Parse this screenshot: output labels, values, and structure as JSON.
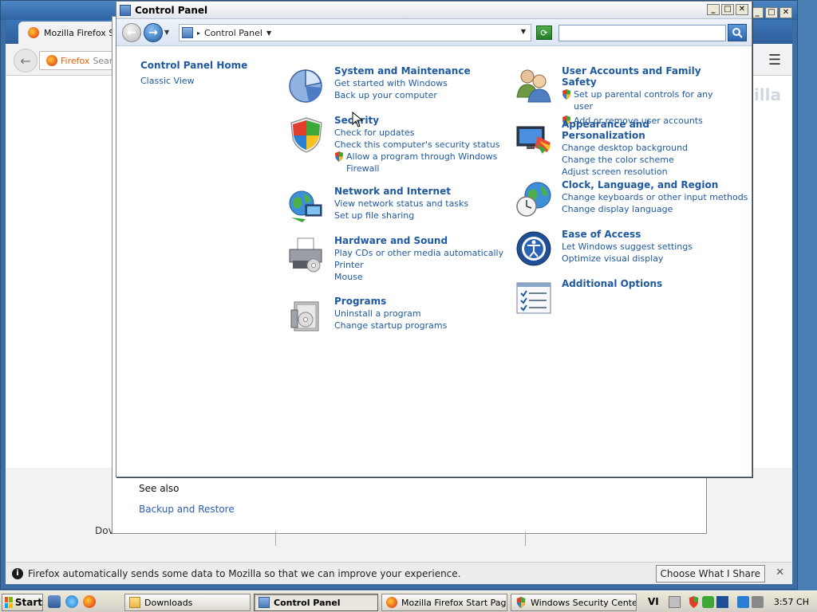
{
  "firefox": {
    "tab_title": "Mozilla Firefox Start",
    "url_badge": "Firefox",
    "url_placeholder": "Search",
    "brand_text": "zilla",
    "partial_text": "Dov",
    "notification": "Firefox automatically sends some data to Mozilla so that we can improve your experience.",
    "share_button": "Choose What I Share"
  },
  "security_window": {
    "see_also": "See also",
    "backup_link": "Backup and Restore"
  },
  "control_panel": {
    "title": "Control Panel",
    "address": "Control Panel",
    "search_placeholder": "",
    "sidebar": {
      "home": "Control Panel Home",
      "classic": "Classic View"
    },
    "categories": [
      {
        "title": "System and Maintenance",
        "icon": "pie-chart-icon",
        "links": [
          {
            "text": "Get started with Windows",
            "shield": false
          },
          {
            "text": "Back up your computer",
            "shield": false
          }
        ]
      },
      {
        "title": "Security",
        "icon": "security-shield-icon",
        "links": [
          {
            "text": "Check for updates",
            "shield": false
          },
          {
            "text": "Check this computer's security status",
            "shield": false
          },
          {
            "text": "Allow a program through Windows Firewall",
            "shield": true
          }
        ]
      },
      {
        "title": "Network and Internet",
        "icon": "globe-network-icon",
        "links": [
          {
            "text": "View network status and tasks",
            "shield": false
          },
          {
            "text": "Set up file sharing",
            "shield": false
          }
        ]
      },
      {
        "title": "Hardware and Sound",
        "icon": "printer-icon",
        "links": [
          {
            "text": "Play CDs or other media automatically",
            "shield": false
          },
          {
            "text": "Printer",
            "shield": false
          },
          {
            "text": "Mouse",
            "shield": false
          }
        ]
      },
      {
        "title": "Programs",
        "icon": "programs-box-icon",
        "links": [
          {
            "text": "Uninstall a program",
            "shield": false
          },
          {
            "text": "Change startup programs",
            "shield": false
          }
        ]
      },
      {
        "title": "User Accounts and Family Safety",
        "icon": "users-icon",
        "links": [
          {
            "text": "Set up parental controls for any user",
            "shield": true
          },
          {
            "text": "Add or remove user accounts",
            "shield": true
          }
        ]
      },
      {
        "title": "Appearance and Personalization",
        "icon": "monitor-paint-icon",
        "links": [
          {
            "text": "Change desktop background",
            "shield": false
          },
          {
            "text": "Change the color scheme",
            "shield": false
          },
          {
            "text": "Adjust screen resolution",
            "shield": false
          }
        ]
      },
      {
        "title": "Clock, Language, and Region",
        "icon": "clock-globe-icon",
        "links": [
          {
            "text": "Change keyboards or other input methods",
            "shield": false
          },
          {
            "text": "Change display language",
            "shield": false
          }
        ]
      },
      {
        "title": "Ease of Access",
        "icon": "ease-of-access-icon",
        "links": [
          {
            "text": "Let Windows suggest settings",
            "shield": false
          },
          {
            "text": "Optimize visual display",
            "shield": false
          }
        ]
      },
      {
        "title": "Additional Options",
        "icon": "checklist-icon",
        "links": []
      }
    ]
  },
  "taskbar": {
    "start": "Start",
    "buttons": [
      {
        "label": "Downloads",
        "active": false
      },
      {
        "label": "Control Panel",
        "active": true
      },
      {
        "label": "Mozilla Firefox Start Pag...",
        "active": false
      },
      {
        "label": "Windows Security Center",
        "active": false
      }
    ],
    "language": "VI",
    "clock": "3:57 CH"
  },
  "colors": {
    "link": "#1f5aa0",
    "desktop": "#4a7fb5"
  }
}
